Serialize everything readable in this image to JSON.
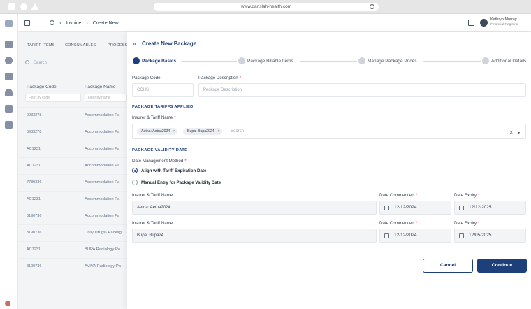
{
  "browser": {
    "url": "www.danslah-health.com"
  },
  "header": {
    "breadcrumb": [
      "Invoice",
      "Create New"
    ],
    "user": {
      "name": "Kathryn Murray",
      "role": "Financial Registrar"
    }
  },
  "background_list": {
    "tabs": [
      "TARIFF ITEMS",
      "CONSUMABLES",
      "PROCESS"
    ],
    "search_placeholder": "Search",
    "columns": [
      "Package Code",
      "Package Name"
    ],
    "filter_placeholders": [
      "Filter by code",
      "Filter by name"
    ],
    "rows": [
      {
        "code": "0933278",
        "name": "Accommodation Pa"
      },
      {
        "code": "0933278",
        "name": "Accommodation Pa"
      },
      {
        "code": "AC1231",
        "name": "Accommodation Pa"
      },
      {
        "code": "AC1231",
        "name": "Accommodation Pa"
      },
      {
        "code": "7789336",
        "name": "Accommodation Pa"
      },
      {
        "code": "AC1231",
        "name": "Accommodation Pa"
      },
      {
        "code": "8190736",
        "name": "Accommodation Pa"
      },
      {
        "code": "8190736",
        "name": "Daily Drugs- Packag"
      },
      {
        "code": "AC1231",
        "name": "BUPA Radiology Pa"
      },
      {
        "code": "8190736",
        "name": "AVIVA Radiology Pa"
      }
    ]
  },
  "drawer": {
    "title": "Create New Package",
    "steps": [
      {
        "label": "Package Basics",
        "active": true
      },
      {
        "label": "Package Billable Items",
        "active": false
      },
      {
        "label": "Manage Package Prices",
        "active": false
      },
      {
        "label": "Additional Details",
        "active": false
      }
    ],
    "package_code": {
      "label": "Package Code",
      "placeholder": "CCHS"
    },
    "package_description": {
      "label": "Package Description",
      "required_mark": "*",
      "placeholder": "Package Description"
    },
    "tariffs_section": "PACKAGE TARIFFS APPLIED",
    "insurer_field": {
      "label": "Insurer & Tariff Name",
      "required_mark": "*",
      "chips": [
        "Aetna: Aetna2024",
        "Bupa: Bupa2024"
      ],
      "chip_remove": "×",
      "search_placeholder": "Search",
      "clear_symbol": "×",
      "caret_symbol": "▾"
    },
    "validity_section": "PACKAGE VALIDITY DATE",
    "date_method": {
      "label": "Date Management Method",
      "required_mark": "*",
      "options": [
        {
          "label": "Align with Tariff Expiration Date",
          "selected": true
        },
        {
          "label": "Manual Entry for Package Validity Date",
          "selected": false
        }
      ]
    },
    "validity_rows": [
      {
        "insurer_label": "Insurer & Tariff Name",
        "insurer_value": "Aetna: Aetna2024",
        "commenced_label": "Date Commenced",
        "commenced_value": "12/12/2024",
        "expiry_label": "Date Expiry",
        "expiry_value": "12/12/2025"
      },
      {
        "insurer_label": "Insurer & Tariff Name",
        "insurer_value": "Bupa: Bupa24",
        "commenced_label": "Date Commenced",
        "commenced_value": "12/12/2024",
        "expiry_label": "Date Expiry",
        "expiry_value": "12/05/2025"
      }
    ],
    "cancel_label": "Cancel",
    "continue_label": "Continue"
  },
  "colors": {
    "primary": "#1d3f7a",
    "required": "#e23b3b"
  }
}
